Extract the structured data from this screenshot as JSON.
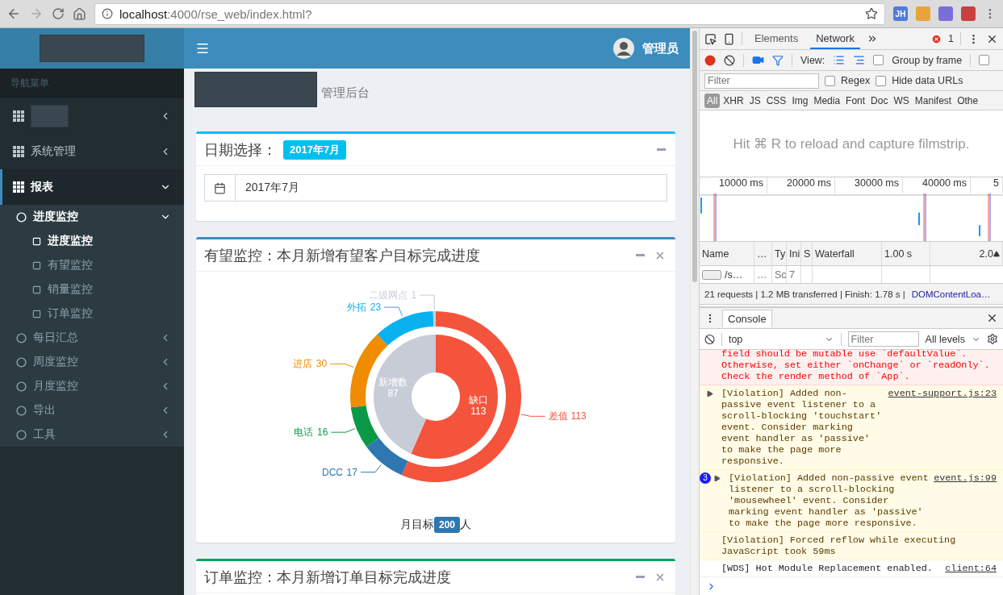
{
  "browser": {
    "url_host": "localhost",
    "url_rest": ":4000/rse_web/index.html?",
    "extension_label": "JH"
  },
  "sidebar": {
    "nav_header": "导航菜单",
    "items": [
      {
        "kind": "redacted",
        "expanded": false,
        "selected": false
      },
      {
        "kind": "label",
        "label": "系统管理",
        "expanded": false,
        "selected": false
      },
      {
        "kind": "label",
        "label": "报表",
        "expanded": true,
        "selected": true,
        "children": [
          {
            "label": "进度监控",
            "expanded": true,
            "children": [
              {
                "label": "进度监控",
                "selected": true
              },
              {
                "label": "有望监控",
                "selected": false
              },
              {
                "label": "销量监控",
                "selected": false
              },
              {
                "label": "订单监控",
                "selected": false
              }
            ]
          },
          {
            "label": "每日汇总",
            "expanded": false
          },
          {
            "label": "周度监控",
            "expanded": false
          },
          {
            "label": "月度监控",
            "expanded": false
          },
          {
            "label": "导出",
            "expanded": false
          },
          {
            "label": "工具",
            "expanded": false
          }
        ]
      }
    ]
  },
  "header": {
    "user": "管理员"
  },
  "content_header": {
    "subtitle": "管理后台"
  },
  "panels": [
    {
      "kind": "date",
      "color": "#00c0ef",
      "closable": false,
      "title": "日期选择：",
      "badge": "2017年7月",
      "input_value": "2017年7月"
    },
    {
      "kind": "chart",
      "color": "#3c8dbc",
      "closable": true,
      "title": "有望监控：本月新增有望客户目标完成进度",
      "inner_ring": {
        "chart_data": {
          "type": "donut",
          "categories": [
            "缺口",
            "新增数"
          ],
          "values": [
            113,
            87
          ],
          "colors": [
            "#f4543c",
            "#c8ccd7"
          ],
          "data_labels": true
        }
      },
      "outer_ring": {
        "chart_data": {
          "type": "donut",
          "categories": [
            "差值",
            "DCC",
            "电话",
            "进店",
            "外拓",
            "二级网点"
          ],
          "values": [
            113,
            17,
            16,
            30,
            23,
            1
          ],
          "colors": [
            "#f4543c",
            "#2e77b0",
            "#0a9a47",
            "#ef8c00",
            "#0ab1ef",
            "#c9ccd8"
          ],
          "data_labels": true
        }
      },
      "footer": {
        "label": "月目标",
        "target": "200",
        "unit": "人"
      }
    },
    {
      "kind": "collapsed",
      "color": "#00a65a",
      "closable": true,
      "title": "订单监控：本月新增订单目标完成进度"
    }
  ],
  "devtools": {
    "tabs": [
      {
        "label": "Elements",
        "selected": false
      },
      {
        "label": "Network",
        "selected": true
      }
    ],
    "error_count": "1",
    "network": {
      "view_label": "View:",
      "options": [
        {
          "label": "Group by frame",
          "checked": false
        },
        {
          "checked": false
        }
      ],
      "filter_placeholder": "Filter",
      "filter_options": [
        {
          "label": "Regex",
          "checked": false
        },
        {
          "label": "Hide data URLs",
          "checked": false
        }
      ],
      "types": [
        {
          "label": "All",
          "selected": true
        },
        {
          "label": "XHR",
          "selected": false
        },
        {
          "label": "JS",
          "selected": false
        },
        {
          "label": "CSS",
          "selected": false
        },
        {
          "label": "Img",
          "selected": false
        },
        {
          "label": "Media",
          "selected": false
        },
        {
          "label": "Font",
          "selected": false
        },
        {
          "label": "Doc",
          "selected": false
        },
        {
          "label": "WS",
          "selected": false
        },
        {
          "label": "Manifest",
          "selected": false
        },
        {
          "label": "Othe",
          "selected": false
        }
      ],
      "filmstrip_hint": "Hit ⌘ R to reload and capture filmstrip.",
      "ticks": [
        "10000 ms",
        "20000 ms",
        "30000 ms",
        "40000 ms",
        "5"
      ],
      "columns": [
        "Name",
        "…",
        "Ty",
        "Ini",
        "S",
        "Waterfall",
        "1.00 s",
        "2.0"
      ],
      "row": [
        "/s…",
        "…",
        "Sc",
        "7"
      ],
      "status": "21 requests | 1.2 MB transferred | Finish: 1.78 s | ",
      "status_link": "DOMContentLoa…"
    },
    "console": {
      "tab": "Console",
      "context": "top",
      "filter_placeholder": "Filter",
      "levels": "All levels",
      "messages": [
        {
          "kind": "error",
          "text": "field should be mutable use `defaultValue`. Otherwise, set either `onChange` or `readOnly`. Check the render method of `App`."
        },
        {
          "kind": "warning",
          "expandable": true,
          "text": "[Violation] Added non-passive event listener to a scroll-blocking 'touchstart' event. Consider marking event handler as 'passive' to make the page more responsive.",
          "source": "event-support.js:23"
        },
        {
          "kind": "warning",
          "expandable": true,
          "count": "3",
          "text": "[Violation] Added non-passive event listener to a scroll-blocking 'mousewheel' event. Consider marking event handler as 'passive' to make the page more responsive.",
          "source": "event.js:99"
        },
        {
          "kind": "warning",
          "expandable": false,
          "text": "[Violation] Forced reflow while executing JavaScript took 59ms"
        },
        {
          "kind": "info",
          "expandable": false,
          "text": "[WDS] Hot Module Replacement enabled.",
          "source": "client:64"
        }
      ]
    }
  }
}
